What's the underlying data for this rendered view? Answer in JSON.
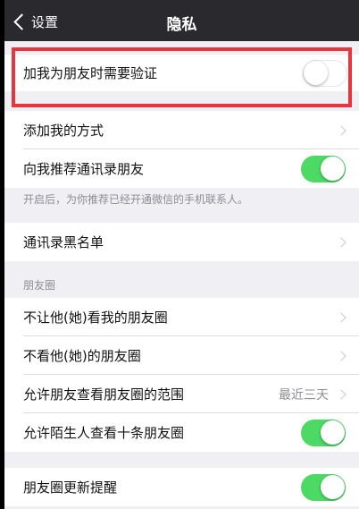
{
  "colors": {
    "nav_bg": "#2a2a2e",
    "toggle_on": "#4cd964",
    "highlight_border": "#e8343c",
    "page_bg": "#efeff4"
  },
  "navbar": {
    "back_label": "设置",
    "back_icon": "chevron-left-icon",
    "title": "隐私"
  },
  "rows": {
    "verify": {
      "label": "加我为朋友时需要验证",
      "toggle": "off"
    },
    "add_method": {
      "label": "添加我的方式"
    },
    "recommend": {
      "label": "向我推荐通讯录朋友",
      "toggle": "on"
    },
    "recommend_note": "开启后，为你推荐已经开通微信的手机联系人。",
    "blacklist": {
      "label": "通讯录黑名单"
    }
  },
  "moments": {
    "header": "朋友圈",
    "block_view_mine": {
      "label": "不让他(她)看我的朋友圈"
    },
    "hide_theirs": {
      "label": "不看他(她)的朋友圈"
    },
    "visible_range": {
      "label": "允许朋友查看朋友圈的范围",
      "value": "最近三天"
    },
    "stranger_view": {
      "label": "允许陌生人查看十条朋友圈",
      "toggle": "on"
    },
    "update_reminder": {
      "label": "朋友圈更新提醒",
      "toggle": "on"
    }
  }
}
